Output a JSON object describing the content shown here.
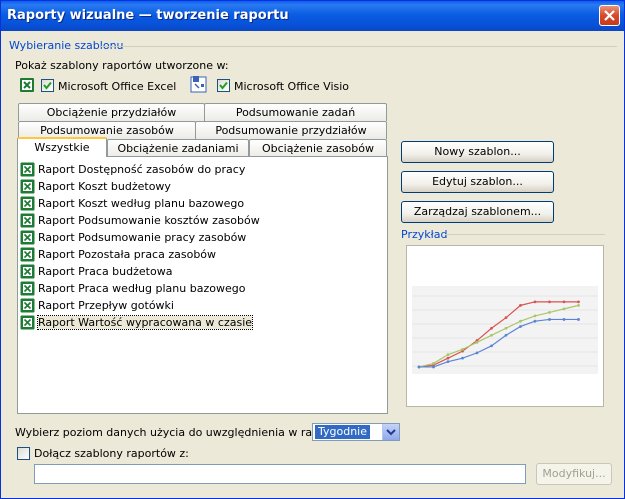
{
  "window": {
    "title": "Raporty wizualne — tworzenie raportu"
  },
  "section": {
    "title": "Wybieranie szablonu"
  },
  "show_label": "Pokaż szablony raportów utworzone w:",
  "apps": [
    {
      "label": "Microsoft Office Excel",
      "checked": true
    },
    {
      "label": "Microsoft Office Visio",
      "checked": true
    }
  ],
  "tabs": {
    "row1": [
      "Obciążenie przydziałów",
      "Podsumowanie zadań"
    ],
    "row2": [
      "Podsumowanie zasobów",
      "Podsumowanie przydziałów"
    ],
    "row3": [
      "Wszystkie",
      "Obciążenie zadaniami",
      "Obciążenie zasobów"
    ],
    "active": "Wszystkie"
  },
  "reports": [
    "Raport Dostępność zasobów do pracy",
    "Raport Koszt budżetowy",
    "Raport Koszt według planu bazowego",
    "Raport Podsumowanie kosztów zasobów",
    "Raport Podsumowanie pracy zasobów",
    "Raport Pozostała praca zasobów",
    "Raport Praca budżetowa",
    "Raport Praca według planu bazowego",
    "Raport Przepływ gotówki",
    "Raport Wartość wypracowana w czasie"
  ],
  "selected_report": "Raport Wartość wypracowana w czasie",
  "buttons": {
    "new": "Nowy szablon...",
    "edit": "Edytuj szablon...",
    "manage": "Zarządzaj szablonem...",
    "modify": "Modyfikuj..."
  },
  "preview": {
    "label": "Przykład",
    "colors": {
      "red": "#d9534f",
      "green": "#a8c66c",
      "blue": "#5b84d6",
      "grid": "#e6e6e6"
    }
  },
  "level": {
    "label": "Wybierz poziom danych użycia do uwzględnienia w raporcie:",
    "value": "Tygodnie"
  },
  "include": {
    "label": "Dołącz szablony raportów z:",
    "checked": false,
    "path": ""
  }
}
